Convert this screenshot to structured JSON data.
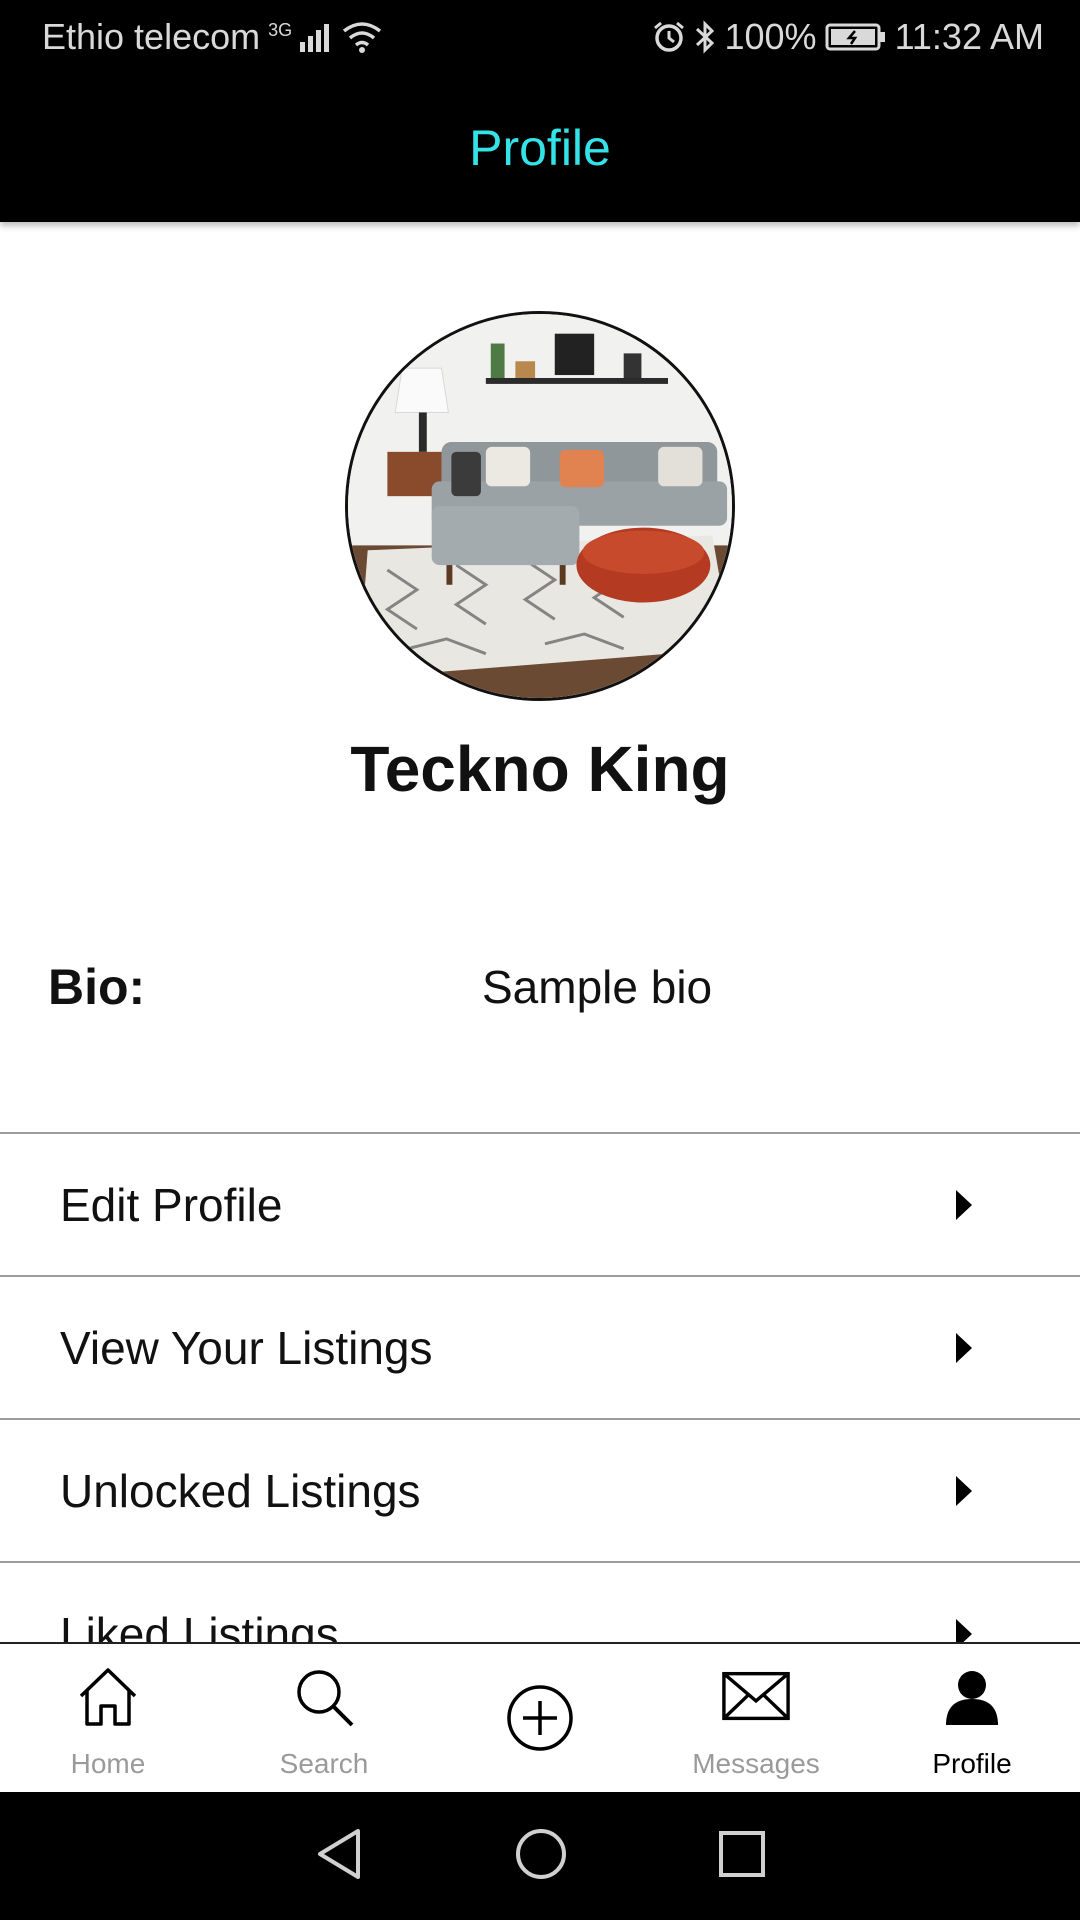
{
  "status_bar": {
    "carrier": "Ethio telecom",
    "network": "3G",
    "battery": "100%",
    "time": "11:32 AM",
    "icons": [
      "signal-icon",
      "wifi-icon",
      "alarm-icon",
      "bluetooth-icon",
      "battery-icon"
    ]
  },
  "header": {
    "title": "Profile",
    "title_color": "#33e3e8"
  },
  "profile": {
    "name": "Teckno King",
    "avatar": "living-room-photo",
    "bio_label": "Bio:",
    "bio_text": "Sample bio"
  },
  "menu": {
    "items": [
      {
        "label": "Edit Profile"
      },
      {
        "label": "View Your Listings"
      },
      {
        "label": "Unlocked Listings"
      },
      {
        "label": "Liked Listings"
      }
    ]
  },
  "bottom_nav": {
    "items": [
      {
        "label": "Home",
        "icon": "home-icon"
      },
      {
        "label": "Search",
        "icon": "search-icon"
      },
      {
        "label": "",
        "icon": "add-circle-icon"
      },
      {
        "label": "Messages",
        "icon": "mail-icon"
      },
      {
        "label": "Profile",
        "icon": "user-icon",
        "active": true
      }
    ]
  },
  "system_nav": {
    "icons": [
      "back-icon",
      "home-circle-icon",
      "recents-icon"
    ]
  }
}
